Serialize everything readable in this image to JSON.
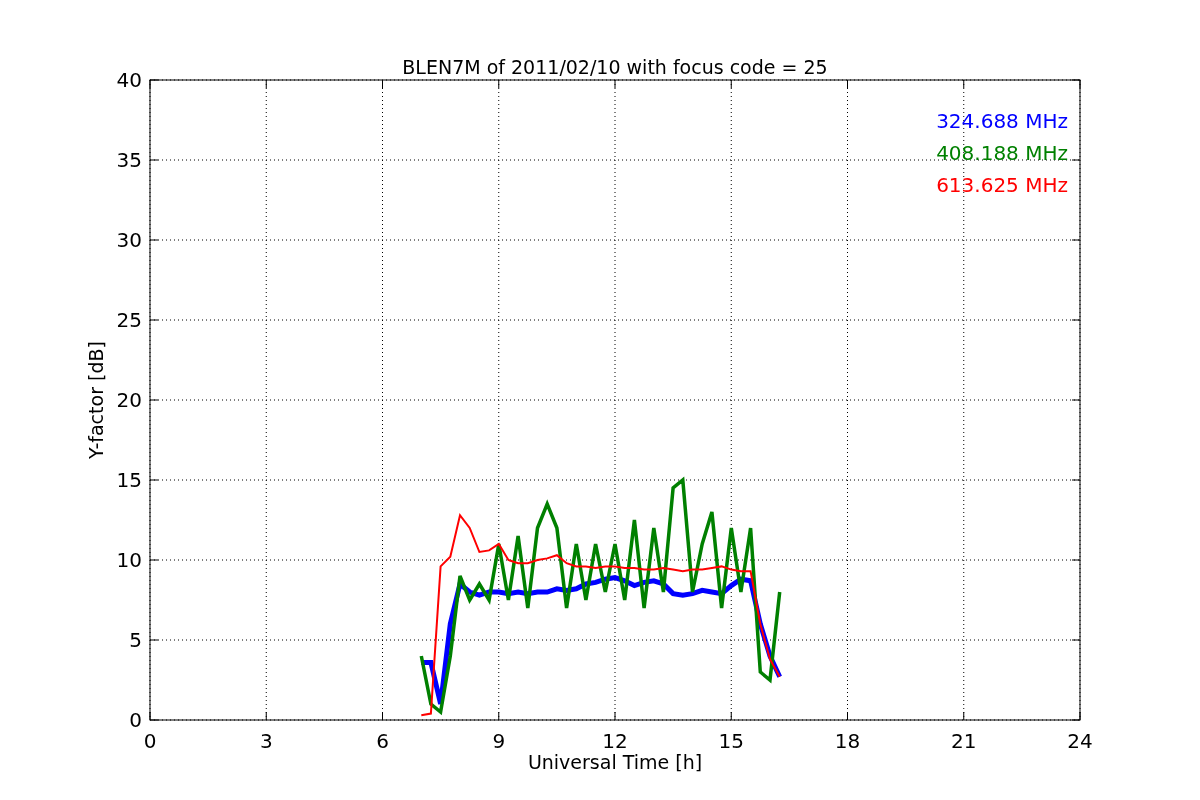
{
  "chart_data": {
    "type": "line",
    "title": "BLEN7M of 2011/02/10 with focus code = 25",
    "xlabel": "Universal Time [h]",
    "ylabel": "Y-factor [dB]",
    "xlim": [
      0,
      24
    ],
    "ylim": [
      0,
      40
    ],
    "xticks": [
      0,
      3,
      6,
      9,
      12,
      15,
      18,
      21,
      24
    ],
    "yticks": [
      0,
      5,
      10,
      15,
      20,
      25,
      30,
      35,
      40
    ],
    "grid": true,
    "x": [
      7,
      7.25,
      7.5,
      7.75,
      8,
      8.25,
      8.5,
      8.75,
      9,
      9.25,
      9.5,
      9.75,
      10,
      10.25,
      10.5,
      10.75,
      11,
      11.25,
      11.5,
      11.75,
      12,
      12.25,
      12.5,
      12.75,
      13,
      13.25,
      13.5,
      13.75,
      14,
      14.25,
      14.5,
      14.75,
      15,
      15.25,
      15.5,
      15.75,
      16,
      16.25
    ],
    "series": [
      {
        "name": "324.688 MHz",
        "color": "#0000ff",
        "values": [
          3.6,
          3.6,
          1,
          6,
          8.5,
          8,
          7.8,
          8,
          8,
          7.9,
          8,
          7.9,
          8,
          8,
          8.2,
          8.1,
          8.2,
          8.5,
          8.6,
          8.8,
          8.9,
          8.7,
          8.4,
          8.6,
          8.7,
          8.5,
          7.9,
          7.8,
          7.9,
          8.1,
          8,
          7.9,
          8.4,
          8.8,
          8.7,
          6,
          4,
          2.7
        ]
      },
      {
        "name": "408.188 MHz",
        "color": "#008000",
        "values": [
          4,
          1,
          0.5,
          4,
          9,
          7.5,
          8.5,
          7.5,
          11,
          7.5,
          11.5,
          7,
          12,
          13.5,
          12,
          7,
          11,
          7.5,
          11,
          8,
          11,
          7.5,
          12.5,
          7,
          12,
          8,
          14.5,
          15,
          8,
          11,
          13,
          7,
          12,
          8,
          12,
          3,
          2.5,
          8
        ]
      },
      {
        "name": "613.625 MHz",
        "color": "#ff0000",
        "values": [
          0.3,
          0.4,
          9.6,
          10.2,
          12.8,
          12,
          10.5,
          10.6,
          11,
          10,
          9.8,
          9.8,
          10,
          10.1,
          10.3,
          9.8,
          9.6,
          9.6,
          9.5,
          9.6,
          9.6,
          9.5,
          9.5,
          9.4,
          9.4,
          9.5,
          9.4,
          9.3,
          9.4,
          9.4,
          9.5,
          9.6,
          9.4,
          9.3,
          9.3,
          6,
          3.8,
          2.7
        ]
      }
    ]
  }
}
